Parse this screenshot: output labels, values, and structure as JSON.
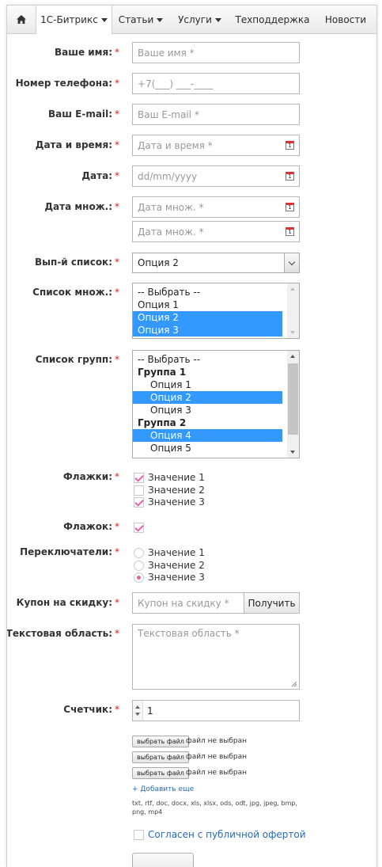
{
  "nav": {
    "home_icon": "home-icon",
    "items": [
      {
        "label": "1С-Битрикс",
        "dropdown": true
      },
      {
        "label": "Статьи",
        "dropdown": true
      },
      {
        "label": "Услуги",
        "dropdown": true
      },
      {
        "label": "Техподдержка",
        "dropdown": false
      },
      {
        "label": "Новости",
        "dropdown": false
      }
    ]
  },
  "required_mark": "*",
  "form": {
    "name": {
      "label": "Ваше имя:",
      "placeholder": "Ваше имя *"
    },
    "phone": {
      "label": "Номер телефона:",
      "mask": "+7(___) ___-____"
    },
    "email": {
      "label": "Ваш E-mail:",
      "placeholder": "Ваш E-mail *"
    },
    "datetime": {
      "label": "Дата и время:",
      "placeholder": "Дата и время *",
      "icon": "calendar-icon"
    },
    "date": {
      "label": "Дата:",
      "placeholder": "dd/mm/yyyy",
      "icon": "calendar-icon"
    },
    "dates_multi": {
      "label": "Дата множ.:",
      "placeholder": "Дата множ. *",
      "icon": "calendar-icon"
    },
    "select": {
      "label": "Вып-й список:",
      "value": "Опция 2"
    },
    "multiselect": {
      "label": "Список множ.:",
      "options": [
        {
          "text": "-- Выбрать --",
          "selected": false
        },
        {
          "text": "Опция 1",
          "selected": false
        },
        {
          "text": "Опция 2",
          "selected": true
        },
        {
          "text": "Опция 3",
          "selected": true
        }
      ]
    },
    "grouplist": {
      "label": "Список групп:",
      "options": [
        {
          "text": "-- Выбрать --",
          "kind": "option",
          "selected": false
        },
        {
          "text": "Группа 1",
          "kind": "group",
          "selected": false
        },
        {
          "text": "Опция 1",
          "kind": "sub",
          "selected": false
        },
        {
          "text": "Опция 2",
          "kind": "sub",
          "selected": true
        },
        {
          "text": "Опция 3",
          "kind": "sub",
          "selected": false
        },
        {
          "text": "Группа 2",
          "kind": "group",
          "selected": false
        },
        {
          "text": "Опция 4",
          "kind": "sub",
          "selected": true
        },
        {
          "text": "Опция 5",
          "kind": "sub",
          "selected": false
        }
      ]
    },
    "checkboxes": {
      "label": "Флажки:",
      "items": [
        {
          "text": "Значение 1",
          "checked": true
        },
        {
          "text": "Значение 2",
          "checked": false
        },
        {
          "text": "Значение 3",
          "checked": true
        }
      ]
    },
    "single_checkbox": {
      "label": "Флажок:",
      "checked": true
    },
    "radios": {
      "label": "Переключатели:",
      "items": [
        {
          "text": "Значение 1",
          "checked": false
        },
        {
          "text": "Значение 2",
          "checked": false
        },
        {
          "text": "Значение 3",
          "checked": true
        }
      ]
    },
    "coupon": {
      "label": "Купон на скидку:",
      "placeholder": "Купон на скидку *",
      "button": "Получить"
    },
    "textarea": {
      "label": "Текстовая область:",
      "placeholder": "Текстовая область *"
    },
    "counter": {
      "label": "Счетчик:",
      "value": "1"
    },
    "files": {
      "button": "выбрать файл",
      "status": "файл не выбран",
      "add_more": "+ Добавить еще",
      "extensions": "txt, rtf, doc, docx, xls, xlsx, ods, odt, jpg, jpeg, bmp, png, mp4"
    },
    "agreement": {
      "text": "Согласен с публичной офертой",
      "checked": false
    }
  },
  "colors": {
    "accent": "#3399ff",
    "check": "#ea5fa8",
    "required": "#e02020",
    "link": "#2a6ab5"
  }
}
